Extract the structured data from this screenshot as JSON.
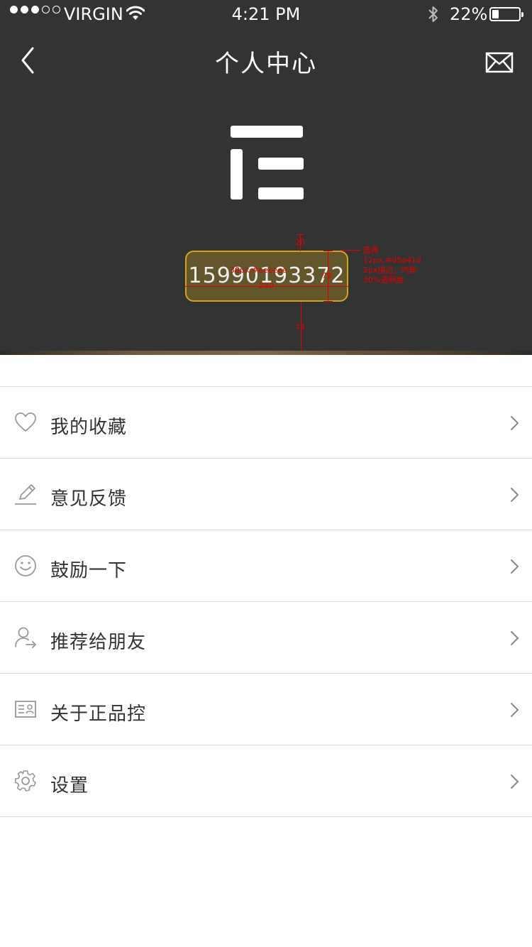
{
  "status_bar": {
    "carrier": "VIRGIN",
    "time": "4:21 PM",
    "battery": "22%",
    "signal_bars_filled": 3,
    "signal_bars_total": 5
  },
  "nav": {
    "title": "个人中心",
    "back_icon": "chevron-left-icon",
    "mail_icon": "mail-icon"
  },
  "profile": {
    "phone": "15990193372"
  },
  "annotations": {
    "top_gap": "20",
    "font_spec": "30px,#eeeeee",
    "width": "230",
    "height": "72",
    "bottom_gap": "74",
    "note_line1": "圆角",
    "note_line2": "12px,#d5a41d",
    "note_line3": "2px描边，内部",
    "note_line4": "30%透明度"
  },
  "menu": [
    {
      "label": "我的收藏",
      "icon": "heart-icon"
    },
    {
      "label": "意见反馈",
      "icon": "pencil-icon"
    },
    {
      "label": "鼓励一下",
      "icon": "smiley-icon"
    },
    {
      "label": "推荐给朋友",
      "icon": "share-user-icon"
    },
    {
      "label": "关于正品控",
      "icon": "id-card-icon"
    },
    {
      "label": "设置",
      "icon": "gear-icon"
    }
  ],
  "colors": {
    "header_bg": "#333333",
    "badge_border": "#d5a41d",
    "badge_text": "#eeeeee",
    "annotation": "#e00000"
  }
}
